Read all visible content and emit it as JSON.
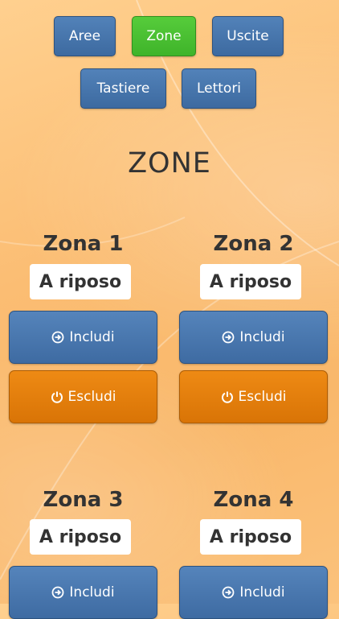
{
  "nav": {
    "items": [
      {
        "label": "Aree",
        "active": false
      },
      {
        "label": "Zone",
        "active": true
      },
      {
        "label": "Uscite",
        "active": false
      },
      {
        "label": "Tastiere",
        "active": false
      },
      {
        "label": "Lettori",
        "active": false
      }
    ]
  },
  "page": {
    "title": "ZONE"
  },
  "zones": [
    {
      "name": "Zona 1",
      "status": "A riposo",
      "include_label": "Includi",
      "exclude_label": "Escludi"
    },
    {
      "name": "Zona 2",
      "status": "A riposo",
      "include_label": "Includi",
      "exclude_label": "Escludi"
    },
    {
      "name": "Zona 3",
      "status": "A riposo",
      "include_label": "Includi"
    },
    {
      "name": "Zona 4",
      "status": "A riposo",
      "include_label": "Includi"
    }
  ],
  "icons": {
    "include": "circle-arrow-right-icon",
    "exclude": "power-icon"
  },
  "colors": {
    "primary": "#4a78ae",
    "active": "#4bbf32",
    "warning": "#e47f0c",
    "background": "#fbbd73"
  }
}
